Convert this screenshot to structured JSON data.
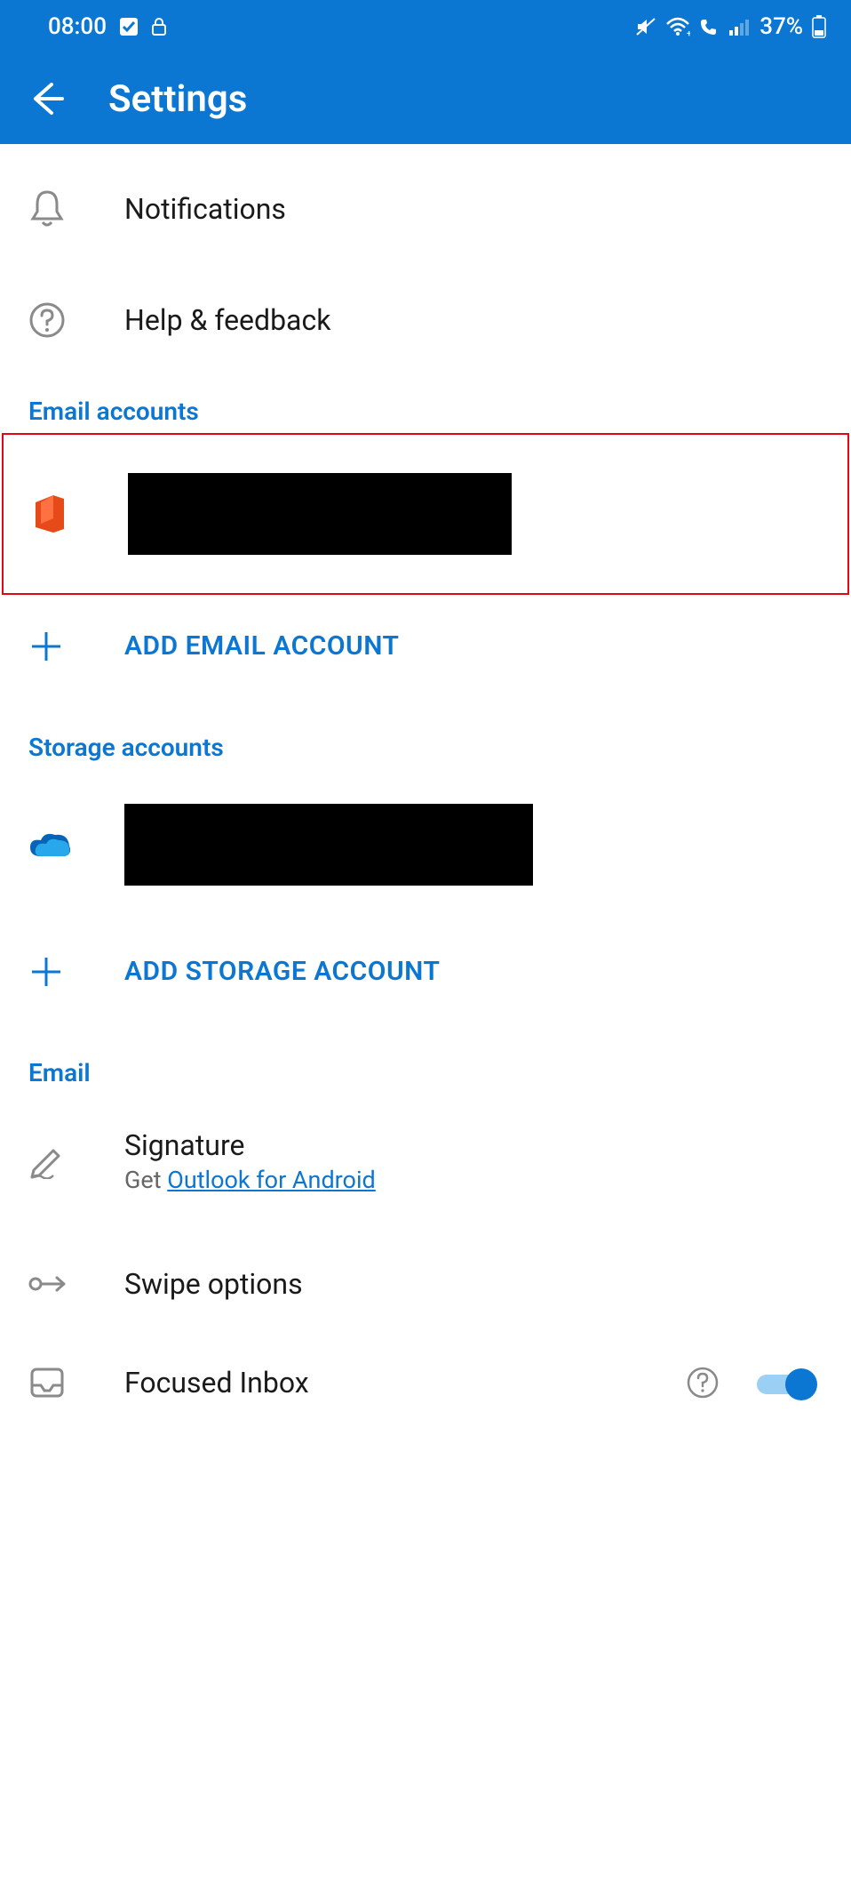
{
  "status": {
    "time": "08:00",
    "battery": "37%"
  },
  "header": {
    "title": "Settings"
  },
  "items": {
    "notifications": "Notifications",
    "help": "Help & feedback",
    "signature": "Signature",
    "signature_sub_prefix": "Get ",
    "signature_link": "Outlook for Android",
    "swipe": "Swipe options",
    "focused": "Focused Inbox"
  },
  "sections": {
    "email_accounts": "Email accounts",
    "storage_accounts": "Storage accounts",
    "email": "Email"
  },
  "actions": {
    "add_email": "ADD EMAIL ACCOUNT",
    "add_storage": "ADD STORAGE ACCOUNT"
  }
}
